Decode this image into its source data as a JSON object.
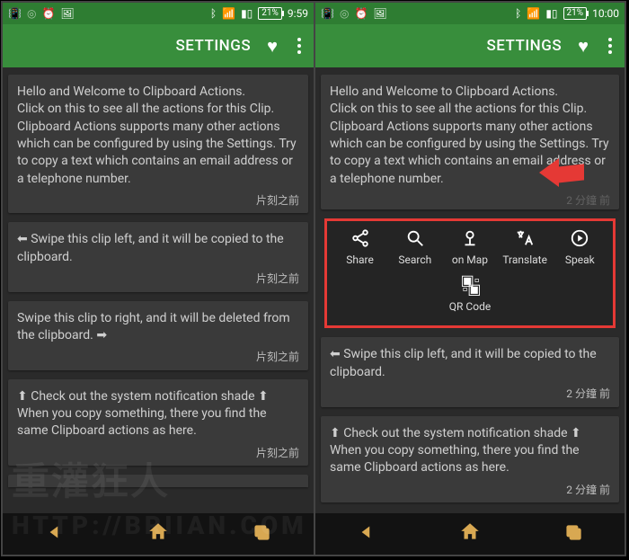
{
  "left": {
    "status_time": "9:59",
    "battery": "21%",
    "appbar_title": "SETTINGS",
    "cards": [
      {
        "text": "Hello and Welcome to Clipboard Actions.\nClick on this to see all the actions for this Clip. Clipboard Actions supports many other actions which can be configured by using the Settings. Try to copy a text which contains an email address or a telephone number.",
        "ts": "片刻之前"
      },
      {
        "text": "⬅ Swipe this clip left, and it will be copied to the clipboard.",
        "ts": "片刻之前"
      },
      {
        "text": "Swipe this clip to right, and it will be deleted from the clipboard. ➡",
        "ts": "片刻之前"
      },
      {
        "text": "⬆ Check out the system notification shade ⬆\nWhen you copy something, there you find the same Clipboard actions as here.",
        "ts": "片刻之前"
      }
    ]
  },
  "right": {
    "status_time": "10:00",
    "battery": "21%",
    "appbar_title": "SETTINGS",
    "first_card": {
      "text": "Hello and Welcome to Clipboard Actions.\nClick on this to see all the actions for this Clip. Clipboard Actions supports many other actions which can be configured by using the Settings. Try to copy a text which contains an email address or a telephone number.",
      "ts": "2 分鐘 前"
    },
    "actions": {
      "share": "Share",
      "search": "Search",
      "map": "on Map",
      "translate": "Translate",
      "speak": "Speak",
      "qr": "QR Code"
    },
    "card2": {
      "text": "⬅ Swipe this clip left, and it will be copied to the clipboard.",
      "ts": "2 分鐘 前"
    },
    "card3": {
      "text": "⬆ Check out the system notification shade ⬆\nWhen you copy something, there you find the same Clipboard actions as here.",
      "ts": "2 分鐘 前"
    }
  },
  "watermark1": "重灌狂人",
  "watermark2": "HTTP://BRIIAN.COM"
}
